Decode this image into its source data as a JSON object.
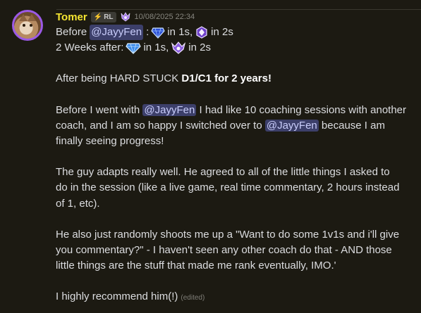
{
  "message": {
    "username": "Tomer",
    "tag": {
      "icon": "lightning-icon",
      "label": "RL"
    },
    "rank_badge": "champion-rank-icon",
    "timestamp": "10/08/2025 22:34",
    "lines": {
      "l1_prefix": "Before",
      "l1_mention": "@JayyFen",
      "l1_colon": ":",
      "l1_mid": "in 1s,",
      "l1_end": "in 2s",
      "l2_prefix": "2 Weeks after:",
      "l2_mid": "in 1s,",
      "l2_end": "in 2s"
    },
    "p1": {
      "text_before": "After being HARD STUCK ",
      "bold": "D1/C1 for 2 years!"
    },
    "p2": {
      "line1_before": "Before I went with ",
      "line1_mention": "@JayyFen",
      "line1_after": " I had like 10 coaching sessions with another",
      "line2_before": "coach, and I am so happy I switched over to ",
      "line2_mention": "@JayyFen",
      "line2_after": " because I am",
      "line3": "finally seeing progress!"
    },
    "p3": {
      "line1": "The guy adapts really well. He agreed to all of the little things I asked to",
      "line2": "do in the session (like a live game, real time commentary, 2 hours instead",
      "line3": "of 1, etc)."
    },
    "p4": {
      "line1": "He also just randomly shoots me up a \"Want to do some 1v1s and i'll give",
      "line2": "you commentary?\" - I haven't seen any other coach do that - AND those",
      "line3": "little things are the stuff that made me rank eventually, IMO.'"
    },
    "p5": {
      "text": "I highly recommend him(!)",
      "edited": "(edited)"
    }
  },
  "icons": {
    "diamond": "diamond-rank-icon",
    "champion": "champion-rank-icon",
    "grand_champion": "grand-champion-rank-icon"
  },
  "colors": {
    "background": "#1c1a12",
    "username": "#f5e531",
    "mention_bg": "#3c3f6a",
    "mention_text": "#c9cdfb",
    "avatar_ring": "#9b59e6"
  }
}
